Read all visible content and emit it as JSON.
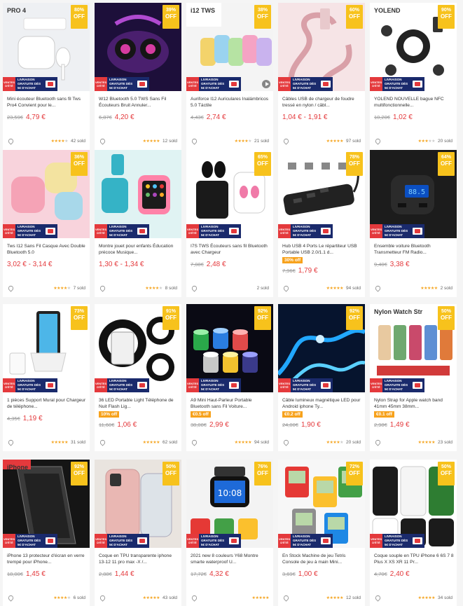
{
  "colors": {
    "accent": "#e4393c",
    "badge": "#f7c21c",
    "star": "#f5a623"
  },
  "badge_off": "OFF",
  "shipping": {
    "tag": "VENTES D'ÉTÉ",
    "text": "LIVRAISON GRATUITE DÈS 5€ D'ACHAT"
  },
  "products": [
    {
      "title": "Mini écouteur Bluetooth sans fil Tws Pro4 Convient pour le...",
      "orig": "23,59€",
      "price": "4,79 €",
      "discount": "80%",
      "rating": 4,
      "sold": "42 sold",
      "image": "earbuds-case",
      "label": "PRO 4"
    },
    {
      "title": "W12 Bluetooth 5.0 TWS Sans Fil Écouteurs Bruit Annuler...",
      "orig": "6,87€",
      "price": "4,20 €",
      "discount": "39%",
      "rating": 5,
      "sold": "12 sold",
      "image": "earbuds-purple"
    },
    {
      "title": "Auriforce I12 Auriculares Inalámbricos 5.0 Táctile",
      "orig": "4,43€",
      "price": "2,74 €",
      "discount": "38%",
      "rating": 4,
      "sold": "21 sold",
      "image": "earbuds-pastel",
      "label": "i12 TWS",
      "video": true
    },
    {
      "title": "Câbles USB de chargeur de foudre tressé en nylon / câbl...",
      "orig": "",
      "price": "1,04 € - 1,91 €",
      "discount": "60%",
      "rating": 5,
      "sold": "97 sold",
      "image": "cable-pink"
    },
    {
      "title": "YOLEND NOUVELLE bague NFC multifonctionnelle...",
      "orig": "10,20€",
      "price": "1,02 €",
      "discount": "90%",
      "rating": 3,
      "sold": "20 sold",
      "image": "ring",
      "label": "YOLEND"
    },
    {
      "title": "Tws I12 Sans Fil Casque Avec Double Bluetooth 5.0",
      "orig": "",
      "price": "3,02 € - 3,14 €",
      "discount": "36%",
      "rating": 4,
      "sold": "7 sold",
      "image": "earbuds-pink"
    },
    {
      "title": "Montre jouet pour enfants Éducation précoce Musique...",
      "orig": "",
      "price": "1,30 € - 1,34 €",
      "discount": "",
      "rating": 4,
      "sold": "8 sold",
      "image": "kids-watch"
    },
    {
      "title": "I7S TWS Écouteurs sans fil Bluetooth avec Chargeur",
      "orig": "7,08€",
      "price": "2,48 €",
      "discount": "65%",
      "rating": 0,
      "sold": "2 sold",
      "image": "earbuds-black"
    },
    {
      "title": "Hub USB 4 Ports Le répartiteur USB Portable USB 2.0/1.1 d...",
      "promo": "30% off",
      "orig": "7,96€",
      "price": "1,79 €",
      "discount": "78%",
      "rating": 5,
      "sold": "94 sold",
      "image": "usb-hub"
    },
    {
      "title": "Ensemble voiture Bluetooth Transmetteur FM Radio...",
      "orig": "9,40€",
      "price": "3,38 €",
      "discount": "64%",
      "rating": 5,
      "sold": "2 sold",
      "image": "fm-transmitter"
    },
    {
      "title": "1 pièces Support Mural pour Chargeur de téléphone...",
      "orig": "4,35€",
      "price": "1,19 €",
      "discount": "73%",
      "rating": 5,
      "sold": "31 sold",
      "image": "wall-holder"
    },
    {
      "title": "36 LED Portable Light Téléphone de Nuit Flash Lig...",
      "promo": "10% off",
      "orig": "11,60€",
      "price": "1,06 €",
      "discount": "91%",
      "rating": 5,
      "sold": "62 sold",
      "image": "ring-light"
    },
    {
      "title": "A9 Mini Haut-Parleur Portable Bluetooth sans Fil Voiture...",
      "promo": "€0.5 off",
      "orig": "38,08€",
      "price": "2,99 €",
      "discount": "92%",
      "rating": 5,
      "sold": "94 sold",
      "image": "speakers"
    },
    {
      "title": "Câble lumineux magnétique LED pour Android iphone Ty...",
      "promo": "€0.2 off",
      "orig": "24,00€",
      "price": "1,90 €",
      "discount": "92%",
      "rating": 4,
      "sold": "20 sold",
      "image": "led-cable"
    },
    {
      "title": "Nylon Strap for Apple watch band 41mm 45mm 38mm...",
      "promo": "€0.1 off",
      "orig": "2,98€",
      "price": "1,49 €",
      "discount": "50%",
      "rating": 5,
      "sold": "23 sold",
      "image": "watch-strap",
      "label": "Nylon Watch Str"
    },
    {
      "title": "iPhone 13 protecteur d'écran en verre trempé pour iPhone...",
      "orig": "18,00€",
      "price": "1,45 €",
      "discount": "92%",
      "rating": 4,
      "sold": "6 sold",
      "image": "screen-protector",
      "label": "iPhone"
    },
    {
      "title": "Coque en TPU transparente iphone 13-12 11 pro max -X /...",
      "orig": "2,88€",
      "price": "1,44 €",
      "discount": "50%",
      "rating": 5,
      "sold": "43 sold",
      "image": "phone-case-clear"
    },
    {
      "title": "2021 new 8 couleurs Y68 Montre smarte waterproof U...",
      "orig": "17,72€",
      "price": "4,32 €",
      "discount": "76%",
      "rating": 5,
      "sold": "",
      "image": "smart-watches"
    },
    {
      "title": "En Stock Machine de jeu Tetris Console de jeu à main Mini...",
      "orig": "3,69€",
      "price": "1,00 €",
      "discount": "72%",
      "rating": 5,
      "sold": "12 sold",
      "image": "tetris-keychain"
    },
    {
      "title": "Coque souple en TPU iPhone 6 6S 7 8 Plus X XS XR 11 Pr...",
      "orig": "4,70€",
      "price": "2,40 €",
      "discount": "50%",
      "rating": 5,
      "sold": "34 sold",
      "image": "phone-cases-pattern"
    }
  ]
}
